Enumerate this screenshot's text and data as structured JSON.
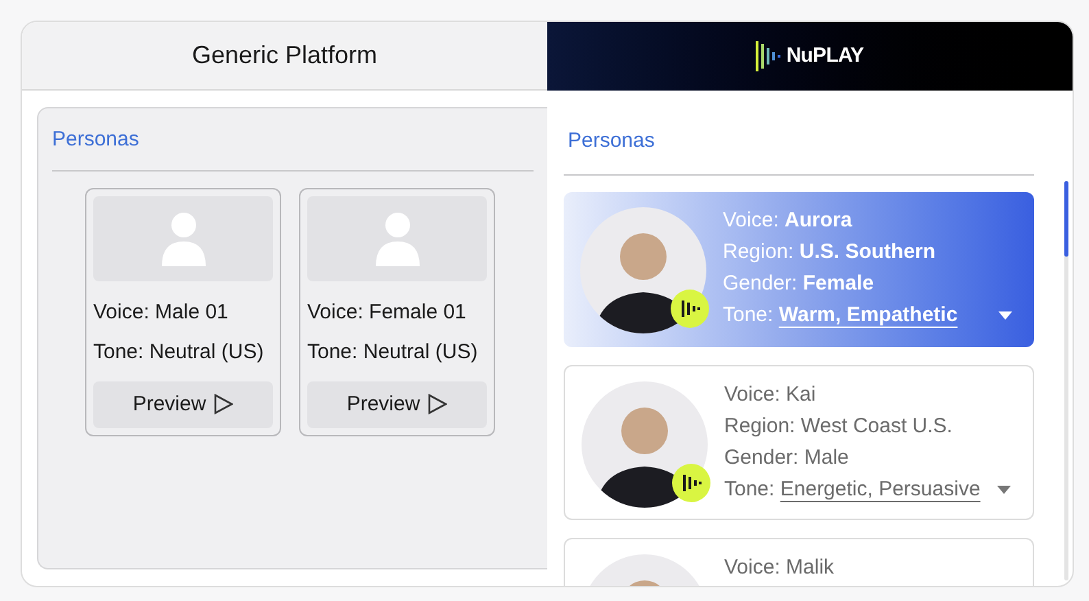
{
  "generic": {
    "title": "Generic Platform",
    "section": "Personas",
    "personas": [
      {
        "voice": "Voice: Male 01",
        "tone": "Tone: Neutral (US)",
        "button": "Preview"
      },
      {
        "voice": "Voice: Female 01",
        "tone": "Tone: Neutral (US)",
        "button": "Preview"
      }
    ]
  },
  "nuplay": {
    "logo": "NuPLAY",
    "section": "Personas",
    "personas": [
      {
        "selected": true,
        "voice_badge": true,
        "fields": [
          {
            "kind": "text",
            "label": "Voice:",
            "value": "Aurora"
          },
          {
            "kind": "text",
            "label": "Region:",
            "value": "U.S. Southern"
          },
          {
            "kind": "text",
            "label": "Gender:",
            "value": "Female"
          },
          {
            "kind": "dropdown",
            "label": "Tone:",
            "value": "Warm, Empathetic"
          }
        ]
      },
      {
        "selected": false,
        "voice_badge": true,
        "fields": [
          {
            "kind": "text",
            "label": "Voice:",
            "value": "Kai"
          },
          {
            "kind": "text",
            "label": "Region:",
            "value": "West Coast U.S."
          },
          {
            "kind": "text",
            "label": "Gender:",
            "value": "Male"
          },
          {
            "kind": "dropdown",
            "label": "Tone:",
            "value": "Energetic, Persuasive"
          }
        ]
      },
      {
        "selected": false,
        "fields": [
          {
            "kind": "text",
            "label": "Voice:",
            "value": "Malik"
          }
        ]
      }
    ]
  }
}
